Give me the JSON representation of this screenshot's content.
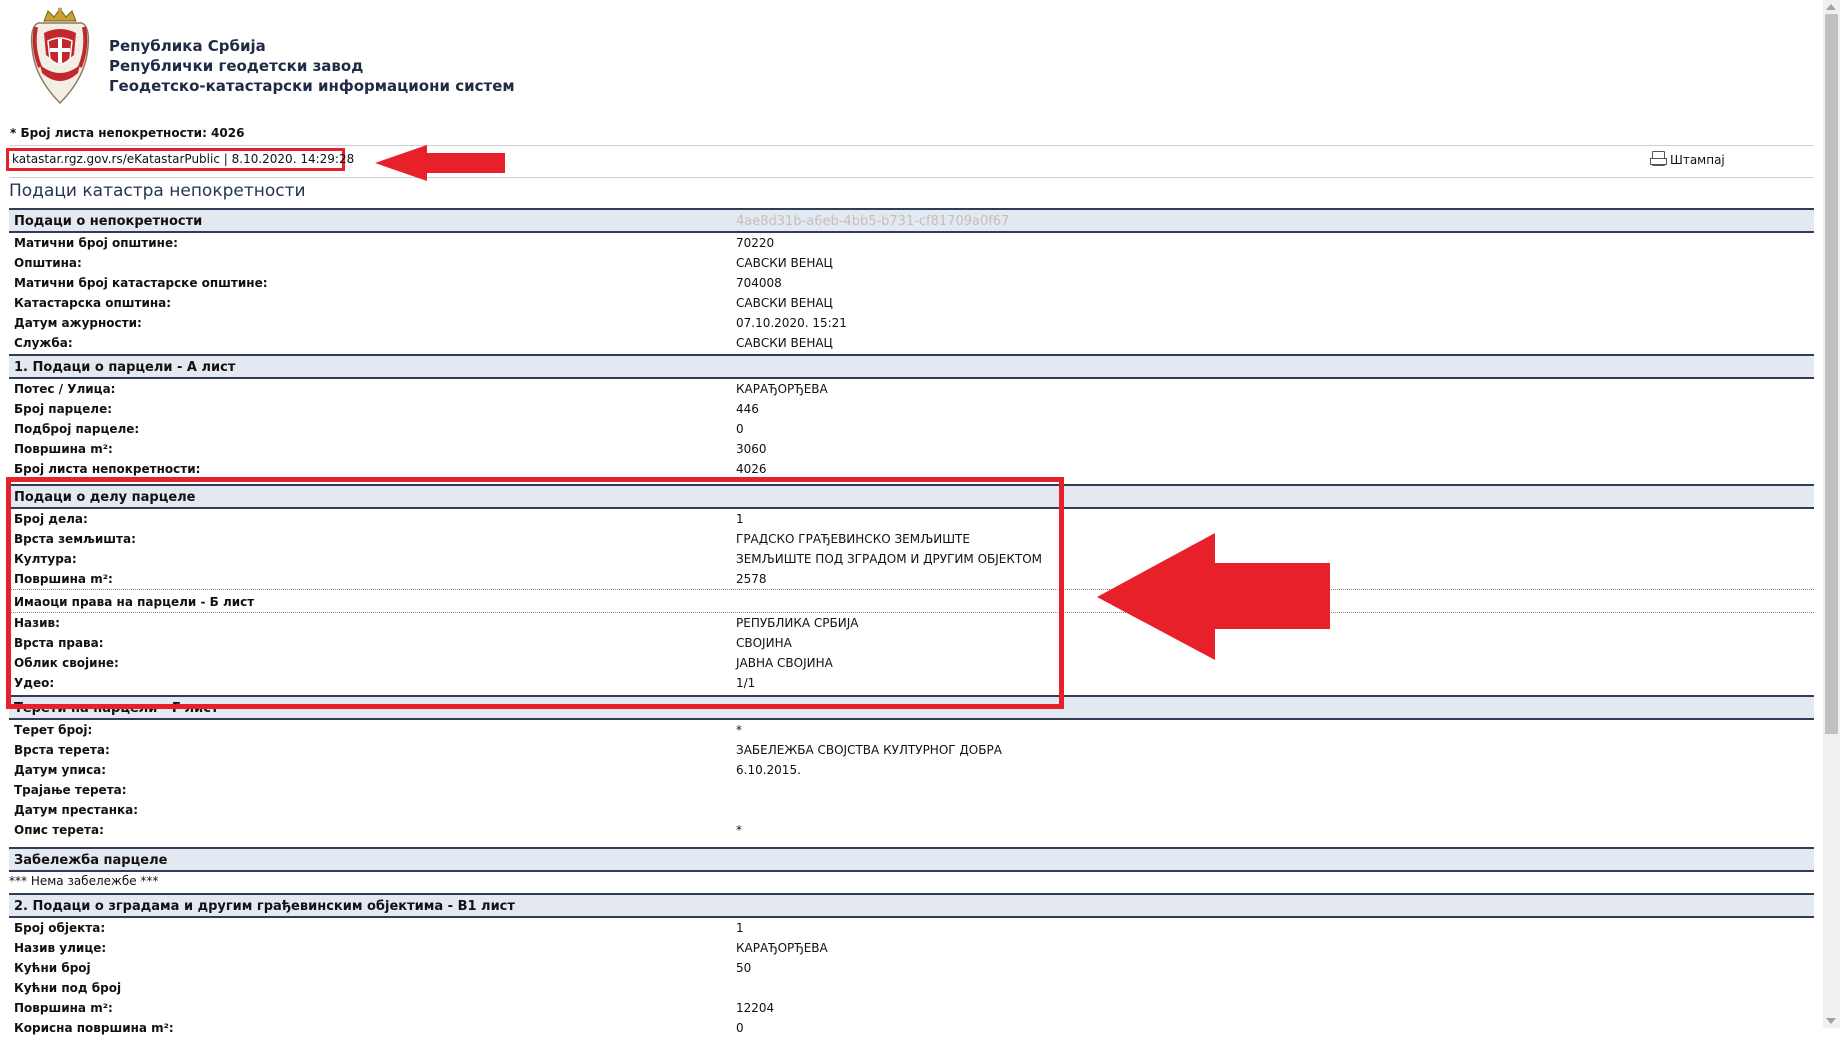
{
  "header": {
    "org_line1": "Република Србија",
    "org_line2": "Републички геодетски завод",
    "org_line3": "Геодетско-катастарски информациони систем",
    "lvn_label": "* Број листа непокретности: 4026",
    "url_text": "katastar.rgz.gov.rs/eKatastarPublic | 8.10.2020. 14:29:28",
    "print_label": "Штампај"
  },
  "page_title": "Подаци катастра непокретности",
  "sec_property": {
    "title": "Подаци о непокретности",
    "guid": "4ae8d31b-a6eb-4bb5-b731-cf81709a0f67"
  },
  "property_rows": [
    {
      "k": "Матични број општине:",
      "v": "70220"
    },
    {
      "k": "Општина:",
      "v": "САВСКИ ВЕНАЦ"
    },
    {
      "k": "Матични број катастарске општине:",
      "v": "704008"
    },
    {
      "k": "Катастарска општина:",
      "v": "САВСКИ ВЕНАЦ"
    },
    {
      "k": "Датум ажурности:",
      "v": "07.10.2020. 15:21"
    },
    {
      "k": "Служба:",
      "v": "САВСКИ ВЕНАЦ"
    }
  ],
  "sec_parcel": {
    "title": "1. Подаци о парцели - А лист"
  },
  "parcel_rows": [
    {
      "k": "Потес / Улица:",
      "v": "КАРАЂОРЂЕВА"
    },
    {
      "k": "Број парцеле:",
      "v": "446"
    },
    {
      "k": "Подброј парцеле:",
      "v": "0"
    },
    {
      "k": "Површина m²:",
      "v": "3060"
    },
    {
      "k": "Број листа непокретности:",
      "v": "4026"
    }
  ],
  "sec_part": {
    "title": "Подаци о делу парцеле"
  },
  "part_rows": [
    {
      "k": "Број дела:",
      "v": "1"
    },
    {
      "k": "Врста земљишта:",
      "v": "ГРАДСКО ГРАЂЕВИНСКО ЗЕМЉИШТЕ"
    },
    {
      "k": "Култура:",
      "v": "ЗЕМЉИШТЕ ПОД ЗГРАДОМ И ДРУГИМ ОБЈЕКТОМ"
    },
    {
      "k": "Површина m²:",
      "v": "2578"
    }
  ],
  "sub_owners": {
    "title": "Имаоци права на парцели - Б лист"
  },
  "owner_rows": [
    {
      "k": "Назив:",
      "v": "РЕПУБЛИКА СРБИЈА"
    },
    {
      "k": "Врста права:",
      "v": "СВОЈИНА"
    },
    {
      "k": "Облик својине:",
      "v": "ЈАВНА СВОЈИНА"
    },
    {
      "k": "Удео:",
      "v": "1/1"
    }
  ],
  "sec_burden": {
    "title": "Терети на парцели - Г лист"
  },
  "burden_rows": [
    {
      "k": "Терет број:",
      "v": "*"
    },
    {
      "k": "Врста терета:",
      "v": "ЗАБЕЛЕЖБА СВОЈСТВА КУЛТУРНОГ ДОБРА"
    },
    {
      "k": "Датум уписа:",
      "v": "6.10.2015."
    },
    {
      "k": "Трајање терета:",
      "v": ""
    },
    {
      "k": "Датум престанка:",
      "v": ""
    },
    {
      "k": "Опис терета:",
      "v": "*"
    }
  ],
  "sec_note": {
    "title": "Забележба парцеле"
  },
  "note_text": "*** Нема забележбе ***",
  "sec_buildings": {
    "title": "2. Подаци о зградама и другим грађевинским објектима - В1 лист"
  },
  "building_rows": [
    {
      "k": "Број објекта:",
      "v": "1"
    },
    {
      "k": "Назив улице:",
      "v": "КАРАЂОРЂЕВА"
    },
    {
      "k": "Кућни број",
      "v": "50"
    },
    {
      "k": "Кућни под број",
      "v": ""
    },
    {
      "k": "Површина m²:",
      "v": "12204"
    },
    {
      "k": "Корисна површина m²:",
      "v": "0"
    }
  ],
  "colors": {
    "highlight": "#e8202a",
    "section_bg": "#e4e9f1",
    "section_border": "#2f3d57"
  }
}
